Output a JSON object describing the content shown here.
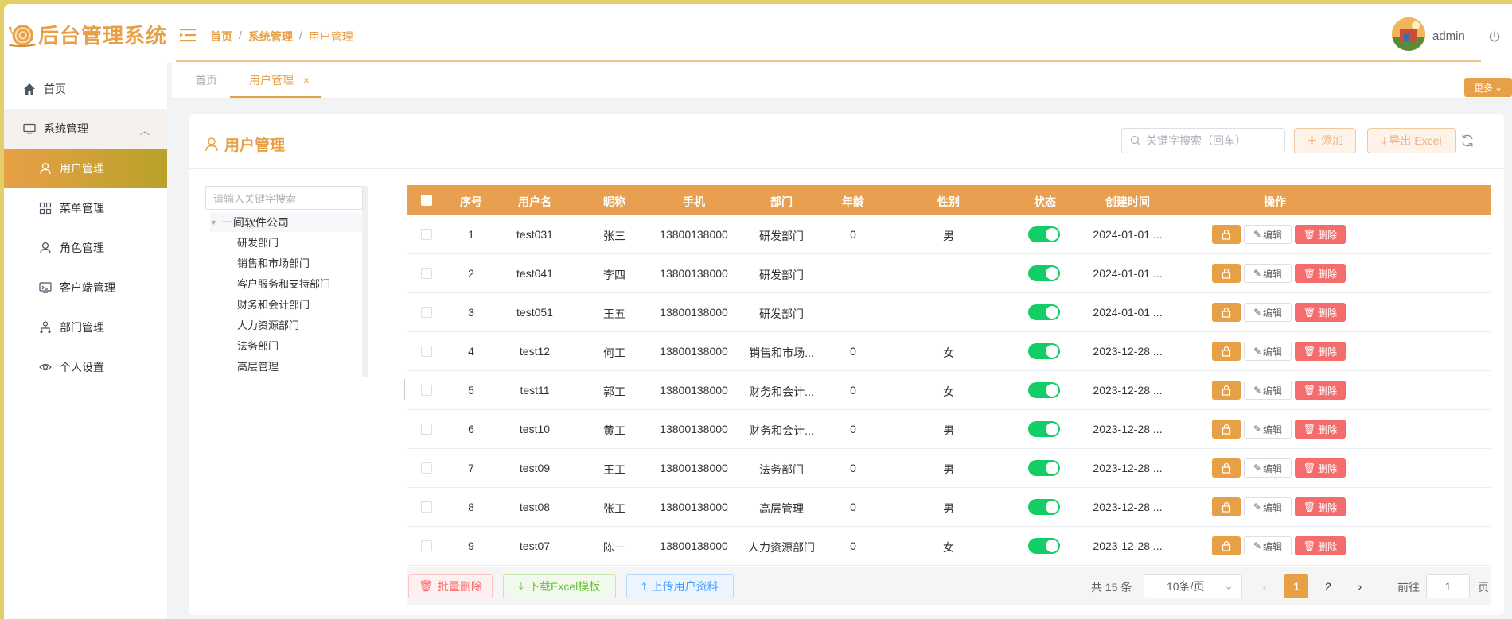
{
  "app": {
    "title": "后台管理系统",
    "accent": "#e8a046"
  },
  "breadcrumb": [
    "首页",
    "系统管理",
    "用户管理"
  ],
  "user": {
    "name": "admin"
  },
  "sidebar": {
    "items": [
      {
        "label": "首页",
        "icon": "home-icon"
      },
      {
        "label": "系统管理",
        "icon": "monitor-icon"
      },
      {
        "label": "用户管理",
        "icon": "user-icon"
      },
      {
        "label": "菜单管理",
        "icon": "grid-icon"
      },
      {
        "label": "角色管理",
        "icon": "user-icon"
      },
      {
        "label": "客户端管理",
        "icon": "display-icon"
      },
      {
        "label": "部门管理",
        "icon": "org-icon"
      },
      {
        "label": "个人设置",
        "icon": "eye-icon"
      }
    ]
  },
  "tabs": [
    {
      "label": "首页"
    },
    {
      "label": "用户管理"
    }
  ],
  "more_label": "更多",
  "card": {
    "title": "用户管理",
    "search_placeholder": "关键字搜索（回车）",
    "add_label": "添加",
    "export_label": "导出 Excel"
  },
  "tree": {
    "placeholder": "请输入关键字搜索",
    "root": "一间软件公司",
    "children": [
      "研发部门",
      "销售和市场部门",
      "客户服务和支持部门",
      "财务和会计部门",
      "人力资源部门",
      "法务部门",
      "高层管理"
    ]
  },
  "table": {
    "headers": [
      "序号",
      "用户名",
      "昵称",
      "手机",
      "部门",
      "年龄",
      "性别",
      "状态",
      "创建时间",
      "操作"
    ],
    "edit_label": "编辑",
    "delete_label": "删除",
    "rows": [
      {
        "no": "1",
        "username": "test031",
        "nickname": "张三",
        "phone": "13800138000",
        "dept": "研发部门",
        "age": "0",
        "gender": "男",
        "created": "2024-01-01 ...",
        "enabled": true
      },
      {
        "no": "2",
        "username": "test041",
        "nickname": "李四",
        "phone": "13800138000",
        "dept": "研发部门",
        "age": "",
        "gender": "",
        "created": "2024-01-01 ...",
        "enabled": true
      },
      {
        "no": "3",
        "username": "test051",
        "nickname": "王五",
        "phone": "13800138000",
        "dept": "研发部门",
        "age": "",
        "gender": "",
        "created": "2024-01-01 ...",
        "enabled": true
      },
      {
        "no": "4",
        "username": "test12",
        "nickname": "何工",
        "phone": "13800138000",
        "dept": "销售和市场...",
        "age": "0",
        "gender": "女",
        "created": "2023-12-28 ...",
        "enabled": true
      },
      {
        "no": "5",
        "username": "test11",
        "nickname": "郭工",
        "phone": "13800138000",
        "dept": "财务和会计...",
        "age": "0",
        "gender": "女",
        "created": "2023-12-28 ...",
        "enabled": true
      },
      {
        "no": "6",
        "username": "test10",
        "nickname": "黄工",
        "phone": "13800138000",
        "dept": "财务和会计...",
        "age": "0",
        "gender": "男",
        "created": "2023-12-28 ...",
        "enabled": true
      },
      {
        "no": "7",
        "username": "test09",
        "nickname": "王工",
        "phone": "13800138000",
        "dept": "法务部门",
        "age": "0",
        "gender": "男",
        "created": "2023-12-28 ...",
        "enabled": true
      },
      {
        "no": "8",
        "username": "test08",
        "nickname": "张工",
        "phone": "13800138000",
        "dept": "高层管理",
        "age": "0",
        "gender": "男",
        "created": "2023-12-28 ...",
        "enabled": true
      },
      {
        "no": "9",
        "username": "test07",
        "nickname": "陈一",
        "phone": "13800138000",
        "dept": "人力资源部门",
        "age": "0",
        "gender": "女",
        "created": "2023-12-28 ...",
        "enabled": true
      }
    ]
  },
  "footer": {
    "batch_delete": "批量删除",
    "download_template": "下载Excel模板",
    "upload_users": "上传用户资料",
    "total": "共 15 条",
    "page_size": "10条/页",
    "pages": [
      "1",
      "2"
    ],
    "goto_label": "前往",
    "goto_value": "1",
    "page_unit": "页"
  }
}
